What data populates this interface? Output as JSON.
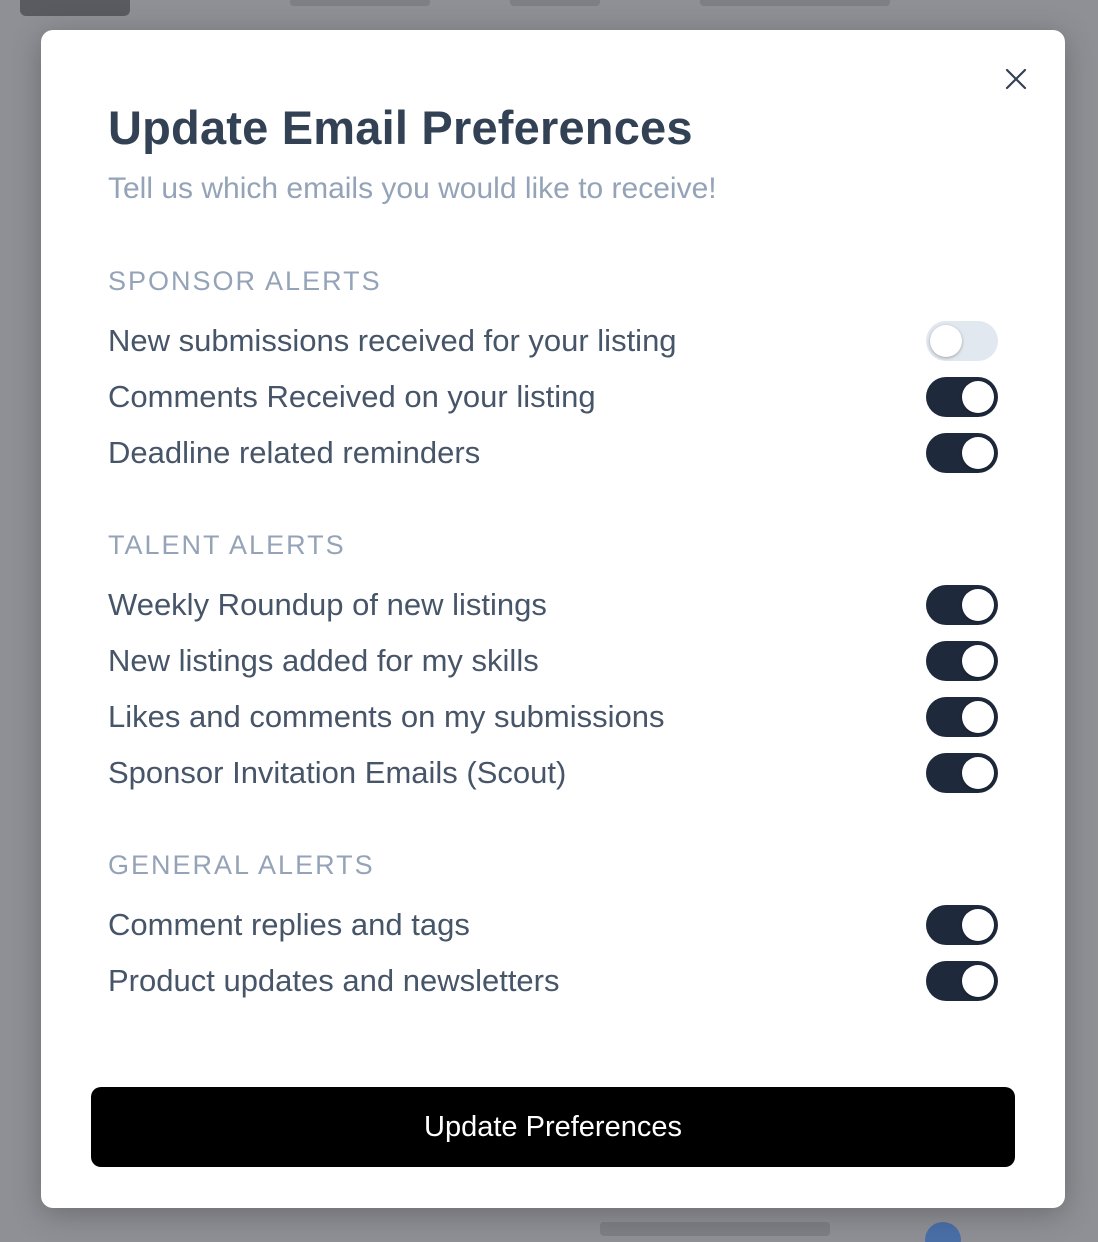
{
  "modal": {
    "title": "Update Email Preferences",
    "subtitle": "Tell us which emails you would like to receive!",
    "close_icon": "close-icon"
  },
  "sections": [
    {
      "label": "SPONSOR ALERTS",
      "items": [
        {
          "label": "New submissions received for your listing",
          "enabled": false
        },
        {
          "label": "Comments Received on your listing",
          "enabled": true
        },
        {
          "label": "Deadline related reminders",
          "enabled": true
        }
      ]
    },
    {
      "label": "TALENT ALERTS",
      "items": [
        {
          "label": "Weekly Roundup of new listings",
          "enabled": true
        },
        {
          "label": "New listings added for my skills",
          "enabled": true
        },
        {
          "label": "Likes and comments on my submissions",
          "enabled": true
        },
        {
          "label": "Sponsor Invitation Emails (Scout)",
          "enabled": true
        }
      ]
    },
    {
      "label": "GENERAL ALERTS",
      "items": [
        {
          "label": "Comment replies and tags",
          "enabled": true
        },
        {
          "label": "Product updates and newsletters",
          "enabled": true
        }
      ]
    }
  ],
  "footer": {
    "update_label": "Update Preferences"
  },
  "colors": {
    "toggle_on": "#1e293b",
    "toggle_off": "#e2e8f0",
    "title": "#334155",
    "muted": "#94a3b8",
    "button": "#000000"
  }
}
